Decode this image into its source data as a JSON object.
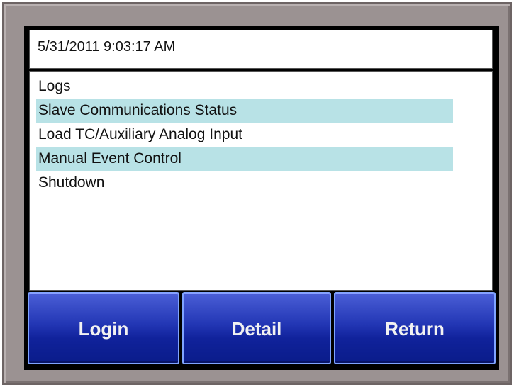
{
  "header": {
    "datetime": "5/31/2011 9:03:17 AM"
  },
  "menu": {
    "items": [
      {
        "label": "Logs"
      },
      {
        "label": "Slave Communications Status"
      },
      {
        "label": "Load TC/Auxiliary Analog Input"
      },
      {
        "label": "Manual Event Control"
      },
      {
        "label": "Shutdown"
      }
    ]
  },
  "buttons": {
    "login": "Login",
    "detail": "Detail",
    "return": "Return"
  },
  "colors": {
    "bezel": "#9b9292",
    "row_highlight": "#b8e2e6",
    "button_blue": "#1a2ea8"
  }
}
